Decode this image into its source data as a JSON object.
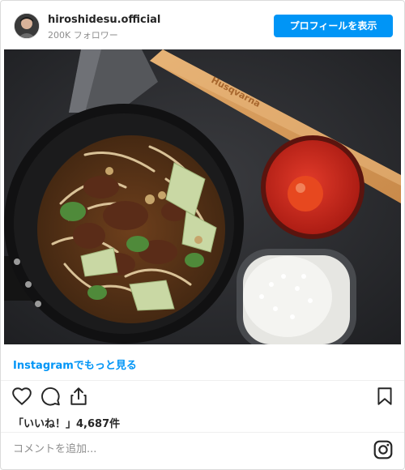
{
  "header": {
    "username": "hiroshidesu.official",
    "followers": "200K フォロワー",
    "profile_button_label": "プロフィールを表示"
  },
  "photo": {
    "axe_brand": "Husqvarna"
  },
  "links": {
    "more_on_instagram": "Instagramでもっと見る"
  },
  "actions": {
    "like_icon": "heart-icon",
    "comment_icon": "comment-bubble-icon",
    "share_icon": "share-icon",
    "save_icon": "bookmark-icon"
  },
  "likes": {
    "label": "「いいね！」4,687件"
  },
  "comment": {
    "placeholder": "コメントを追加..."
  },
  "colors": {
    "accent": "#0095f6",
    "text": "#262626",
    "muted": "#8e8e8e",
    "border": "#dbdbdb"
  }
}
